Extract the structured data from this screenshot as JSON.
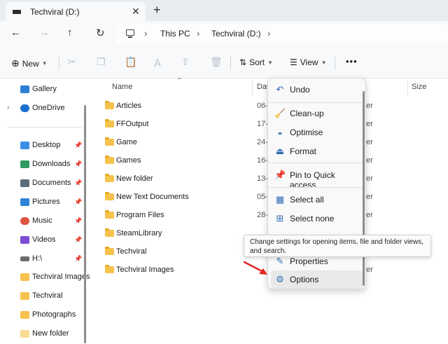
{
  "window": {
    "tab_title": "Techviral (D:)",
    "tab_close": "✕",
    "new_tab": "+"
  },
  "nav": {
    "back": "←",
    "forward": "→",
    "up": "↑",
    "refresh": "↻"
  },
  "breadcrumb": {
    "sep": "›",
    "items": [
      "This PC",
      "Techviral (D:)"
    ]
  },
  "toolbar": {
    "new_label": "New",
    "sort_label": "Sort",
    "view_label": "View",
    "more_label": "•••",
    "icons": [
      "cut-icon",
      "copy-icon",
      "paste-icon",
      "rename-icon",
      "share-icon",
      "delete-icon"
    ]
  },
  "sidebar": {
    "items": [
      {
        "label": "Gallery",
        "icon": "gallery-icon",
        "color": "#2d7fd3",
        "pinned": false
      },
      {
        "label": "OneDrive",
        "icon": "onedrive-icon",
        "color": "#1b6fcf",
        "pinned": false
      },
      {
        "label": "Desktop",
        "icon": "desktop-icon",
        "color": "#3a8ee6",
        "pinned": true
      },
      {
        "label": "Downloads",
        "icon": "downloads-icon",
        "color": "#2e9a62",
        "pinned": true
      },
      {
        "label": "Documents",
        "icon": "documents-icon",
        "color": "#5b6b7c",
        "pinned": true
      },
      {
        "label": "Pictures",
        "icon": "pictures-icon",
        "color": "#2d84d8",
        "pinned": true
      },
      {
        "label": "Music",
        "icon": "music-icon",
        "color": "#e0533f",
        "pinned": true
      },
      {
        "label": "Videos",
        "icon": "videos-icon",
        "color": "#7b4fd4",
        "pinned": true
      },
      {
        "label": "H:\\",
        "icon": "drive-icon",
        "color": "#6b6b6b",
        "pinned": true
      },
      {
        "label": "Techviral Images",
        "icon": "folder-icon",
        "color": "#f5c24b",
        "pinned": false
      },
      {
        "label": "Techviral",
        "icon": "folder-icon",
        "color": "#f5c24b",
        "pinned": false
      },
      {
        "label": "Photographs",
        "icon": "folder-icon",
        "color": "#f5c24b",
        "pinned": false
      },
      {
        "label": "New folder",
        "icon": "folder-icon",
        "color": "#f5c24b",
        "pinned": false
      }
    ],
    "pin_glyph": "📌",
    "chevron": "›"
  },
  "filelist": {
    "columns": {
      "name": "Name",
      "date": "Dat",
      "size": "Size"
    },
    "rows": [
      {
        "name": "Articles",
        "date": "06-",
        "type": "er"
      },
      {
        "name": "FFOutput",
        "date": "17-",
        "type": "er"
      },
      {
        "name": "Game",
        "date": "24-",
        "type": "er"
      },
      {
        "name": "Games",
        "date": "16-",
        "type": "er"
      },
      {
        "name": "New folder",
        "date": "13-",
        "type": "er"
      },
      {
        "name": "New Text Documents",
        "date": "05-",
        "type": "er"
      },
      {
        "name": "Program Files",
        "date": "28-",
        "type": "er"
      },
      {
        "name": "SteamLibrary",
        "date": "",
        "type": ""
      },
      {
        "name": "Techviral",
        "date": "",
        "type": ""
      },
      {
        "name": "Techviral Images",
        "date": "",
        "type": "er"
      }
    ]
  },
  "menu": {
    "items": [
      {
        "label": "Undo",
        "icon": "undo-icon",
        "glyph": "↶"
      },
      {
        "label": "Clean-up",
        "icon": "cleanup-icon",
        "glyph": "🧹"
      },
      {
        "label": "Optimise",
        "icon": "optimise-icon",
        "glyph": "◒"
      },
      {
        "label": "Format",
        "icon": "format-icon",
        "glyph": "⏏"
      },
      {
        "label": "Pin to Quick access",
        "icon": "pin-icon",
        "glyph": "📌"
      },
      {
        "label": "Select all",
        "icon": "select-all-icon",
        "glyph": "▦"
      },
      {
        "label": "Select none",
        "icon": "select-none-icon",
        "glyph": "⊞"
      },
      {
        "label": "Properties",
        "icon": "properties-icon",
        "glyph": "✎"
      },
      {
        "label": "Options",
        "icon": "options-icon",
        "glyph": "⚙"
      }
    ]
  },
  "tooltip": {
    "text": "Change settings for opening items, file and folder views, and search."
  },
  "colors": {
    "accent": "#2b6cb0",
    "annotation_arrow": "#e02424"
  }
}
